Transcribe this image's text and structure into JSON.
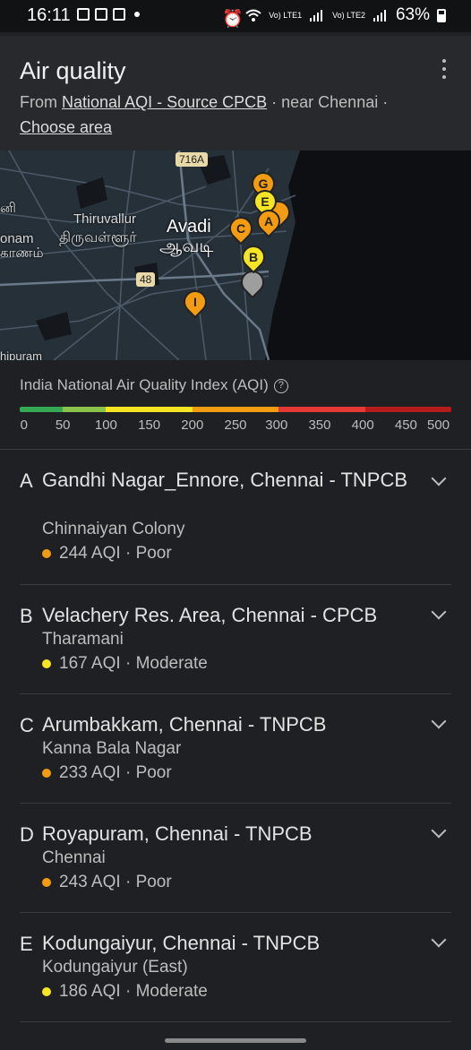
{
  "status_bar": {
    "time": "16:11",
    "network1": "Vo) LTE1",
    "network2": "Vo) LTE2",
    "battery": "63%"
  },
  "header": {
    "title": "Air quality",
    "from_prefix": "From",
    "source_link": "National AQI - Source CPCB",
    "near_text": "· near Chennai ·",
    "choose_area": "Choose area"
  },
  "map": {
    "labels": {
      "thiruvallur_en": "Thiruvallur",
      "thiruvallur_ta": "திருவள்ளூர்",
      "avadi_en": "Avadi",
      "avadi_ta": "ஆவடி",
      "left_en": "onam",
      "left_ta": "காணம்",
      "left_top": "னி",
      "bottom": "hipuram",
      "road_716a": "716A",
      "road_48": "48"
    },
    "pins": [
      {
        "letter": "G",
        "color": "orange"
      },
      {
        "letter": "E",
        "color": "yellow"
      },
      {
        "letter": "",
        "color": "orange"
      },
      {
        "letter": "A",
        "color": "orange"
      },
      {
        "letter": "C",
        "color": "orange"
      },
      {
        "letter": "B",
        "color": "yellow"
      },
      {
        "letter": "I",
        "color": "orange"
      },
      {
        "letter": "",
        "color": "grey"
      }
    ]
  },
  "legend": {
    "title": "India National Air Quality Index (AQI)",
    "ticks": [
      "0",
      "50",
      "100",
      "150",
      "200",
      "250",
      "300",
      "350",
      "400",
      "450",
      "500"
    ],
    "colors": [
      "#34a853",
      "#8bc34a",
      "#f5e523",
      "#f39c12",
      "#e53935",
      "#b71c1c"
    ]
  },
  "stations": [
    {
      "letter": "A",
      "name": "Gandhi Nagar_Ennore, Chennai - TNPCB",
      "area": "Chinnaiyan Colony",
      "aqi": "244 AQI",
      "category": "Poor",
      "color": "#f39c12"
    },
    {
      "letter": "B",
      "name": "Velachery Res. Area, Chennai - CPCB",
      "area": "Tharamani",
      "aqi": "167 AQI",
      "category": "Moderate",
      "color": "#f5e523"
    },
    {
      "letter": "C",
      "name": "Arumbakkam, Chennai - TNPCB",
      "area": "Kanna Bala Nagar",
      "aqi": "233 AQI",
      "category": "Poor",
      "color": "#f39c12"
    },
    {
      "letter": "D",
      "name": "Royapuram, Chennai - TNPCB",
      "area": "Chennai",
      "aqi": "243 AQI",
      "category": "Poor",
      "color": "#f39c12"
    },
    {
      "letter": "E",
      "name": "Kodungaiyur, Chennai - TNPCB",
      "area": "Kodungaiyur (East)",
      "aqi": "186 AQI",
      "category": "Moderate",
      "color": "#f5e523"
    }
  ],
  "separator": "·"
}
